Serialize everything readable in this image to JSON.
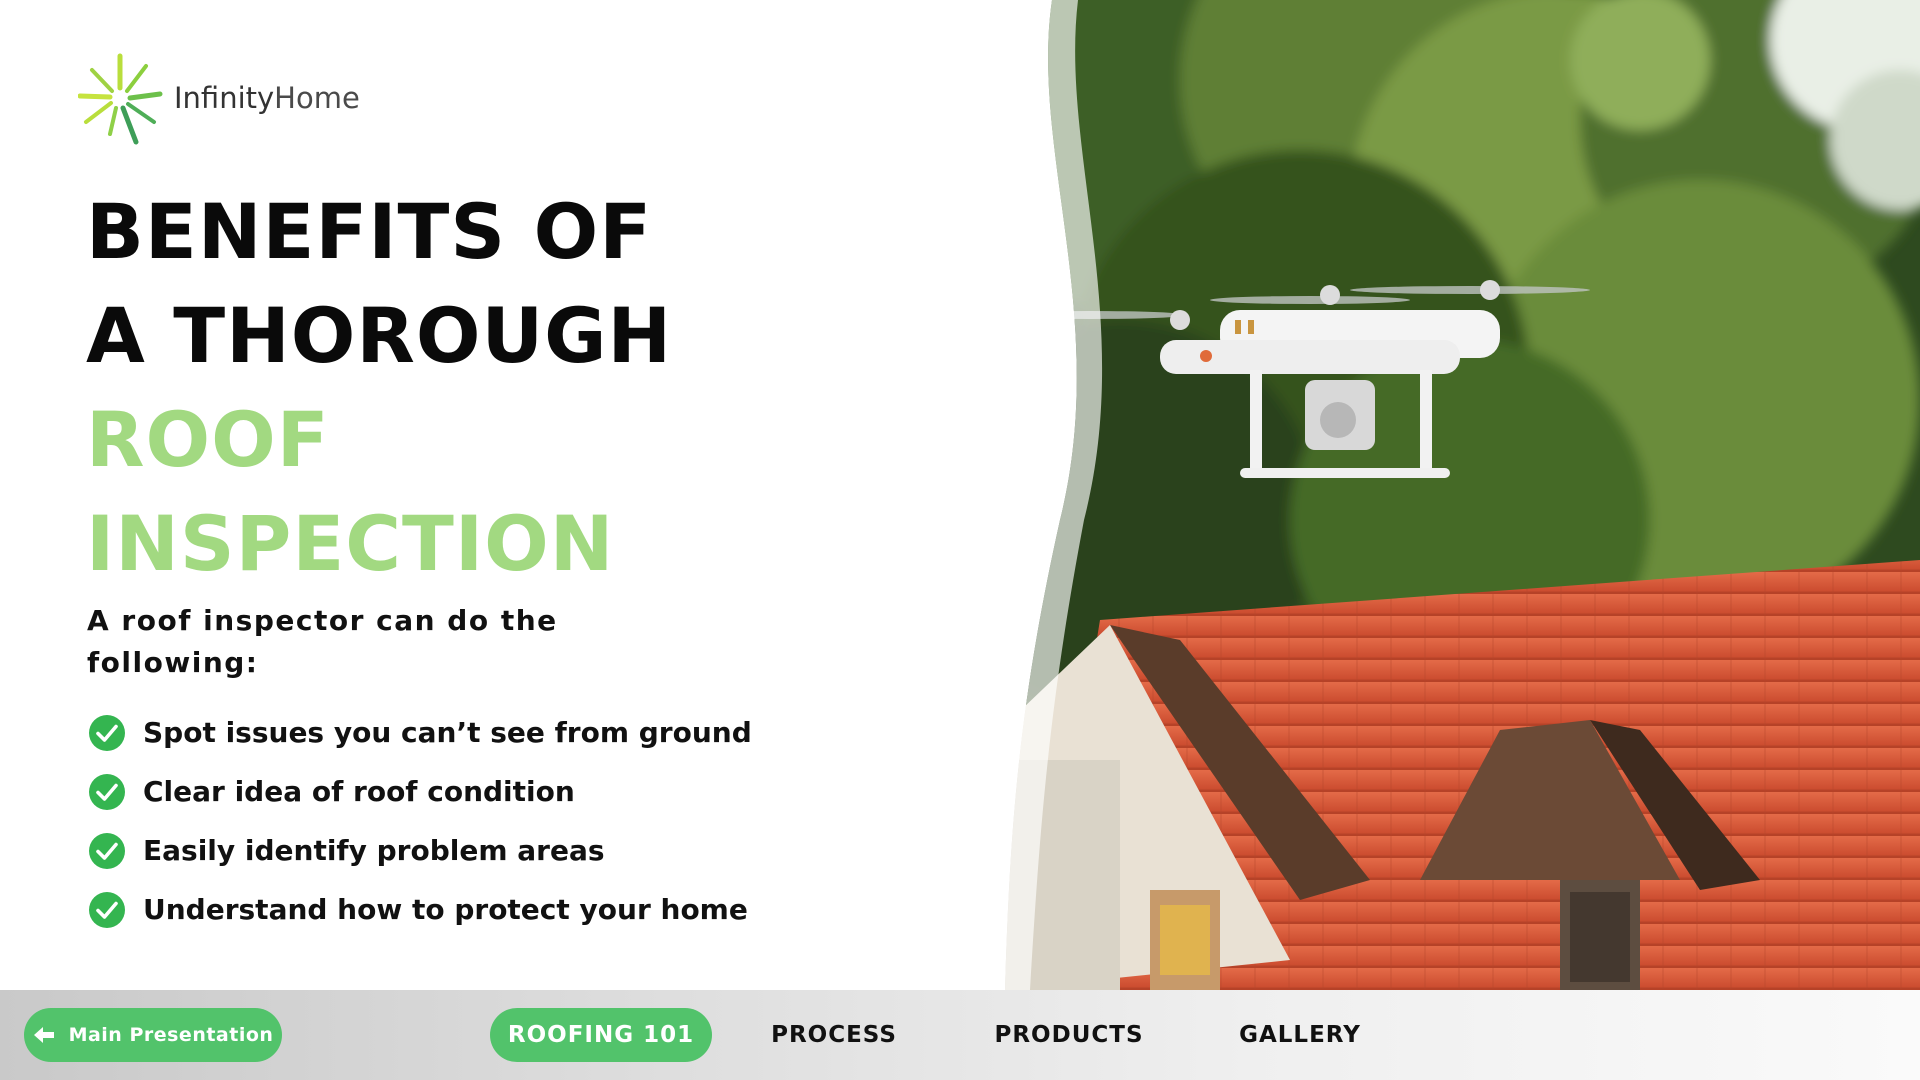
{
  "brand": {
    "name_part1": "Infinity",
    "name_part2": "Home",
    "accent_green": "#a2d981",
    "button_green": "#52c36b"
  },
  "slide": {
    "title_lines": [
      "BENEFITS OF",
      "A THOROUGH",
      "ROOF",
      "INSPECTION"
    ],
    "intro": "A roof inspector can do the following:",
    "bullets": [
      "Spot issues you can’t see from ground",
      "Clear idea of roof condition",
      "Easily identify problem areas",
      "Understand how to protect your home"
    ],
    "photo_icon": "drone-over-roof-photo"
  },
  "nav": {
    "back_label": "Main Presentation",
    "back_icon": "arrow-left-icon",
    "items": [
      "ROOFING 101",
      "PROCESS",
      "PRODUCTS",
      "GALLERY"
    ],
    "active_index": 0
  }
}
